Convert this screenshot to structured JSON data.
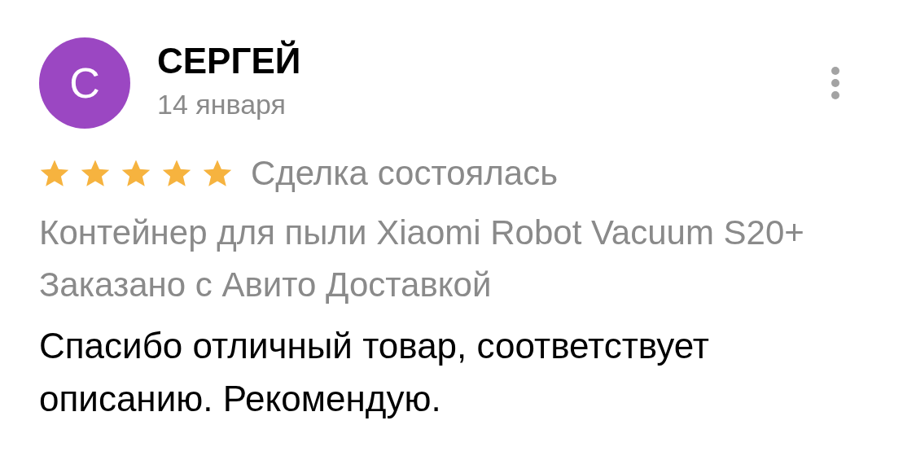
{
  "review": {
    "avatar_letter": "С",
    "author": "СЕРГЕЙ",
    "date": "14 января",
    "stars": 5,
    "status": "Сделка состоялась",
    "product": "Контейнер для пыли Xiaomi Robot Vacuum S20+",
    "delivery": "Заказано с Авито Доставкой",
    "text": "Спасибо отличный товар, соответствует описанию. Рекомендую."
  }
}
